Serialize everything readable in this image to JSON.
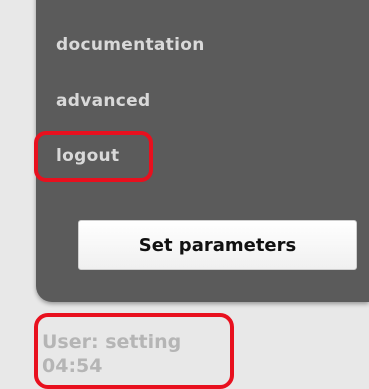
{
  "menu": {
    "items": [
      {
        "label": "documentation"
      },
      {
        "label": "advanced"
      },
      {
        "label": "logout"
      }
    ]
  },
  "actions": {
    "set_parameters_label": "Set parameters"
  },
  "status": {
    "user_text": "User: setting",
    "time": "04:54"
  },
  "colors": {
    "panel_bg": "#5b5b5b",
    "page_bg": "#e8e8e8",
    "highlight": "#e8101e"
  }
}
